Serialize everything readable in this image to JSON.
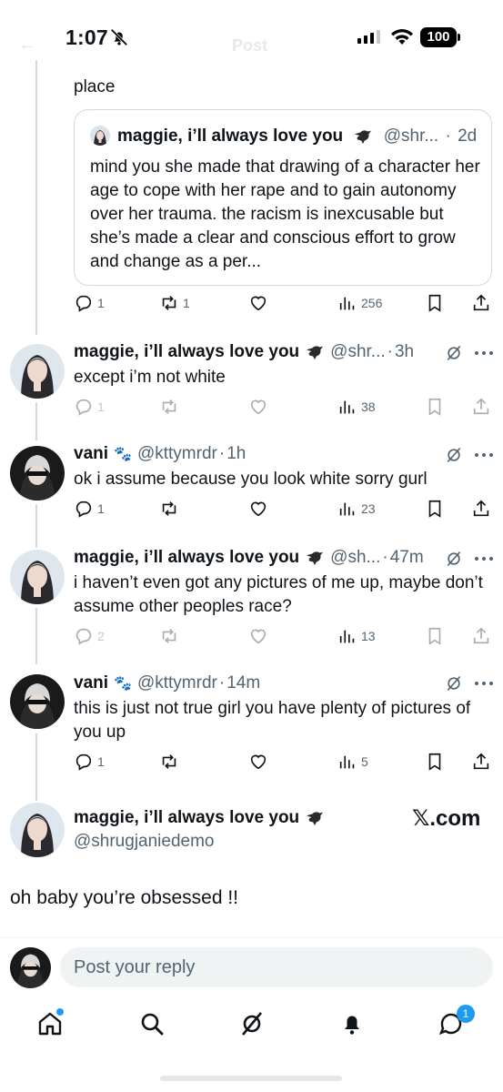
{
  "status_bar": {
    "time": "1:07",
    "battery": "100"
  },
  "header": {
    "title": "Post"
  },
  "previous_tweet": {
    "text_tail": "place"
  },
  "quote": {
    "name": "maggie, i’ll always love you",
    "handle": "@shr...",
    "time": "2d",
    "text": "mind you she made that drawing of a character her age to cope with her rape and to gain autonomy over her trauma. the racism is inexcusable but she’s made a clear and conscious effort to grow and change as a per..."
  },
  "quote_actions": {
    "replies": "1",
    "reposts": "1",
    "views": "256"
  },
  "tweets": [
    {
      "name": "maggie, i’ll always love you",
      "handle": "@shr...",
      "time": "3h",
      "text": "except i’m not white",
      "replies": "1",
      "reposts": "",
      "likes": "",
      "views": "38"
    },
    {
      "name": "vani",
      "handle": "@kttymrdr",
      "time": "1h",
      "text": "ok i assume because you look white sorry gurl",
      "replies": "1",
      "reposts": "",
      "likes": "",
      "views": "23"
    },
    {
      "name": "maggie, i’ll always love you",
      "handle": "@sh...",
      "time": "47m",
      "text": "i haven’t even got any pictures of me up, maybe don’t assume other peoples race?",
      "replies": "2",
      "reposts": "",
      "likes": "",
      "views": "13"
    },
    {
      "name": "vani",
      "handle": "@kttymrdr",
      "time": "14m",
      "text": "this is just not true girl you have plenty of pictures of you up",
      "replies": "1",
      "reposts": "",
      "likes": "",
      "views": "5"
    }
  ],
  "main_tweet": {
    "name": "maggie, i’ll always love you",
    "handle": "@shrugjaniedemo",
    "text": "oh baby you’re obsessed !!",
    "watermark": "𝕏.com"
  },
  "reply": {
    "placeholder": "Post your reply"
  },
  "tabbar": {
    "messages_badge": "1"
  },
  "colors": {
    "accent": "#1d9bf0",
    "text": "#0f1419",
    "secondary": "#536471",
    "border": "#cfd9de"
  },
  "icons": [
    "reply-icon",
    "repost-icon",
    "like-icon",
    "views-icon",
    "bookmark-icon",
    "share-icon",
    "grok-icon",
    "more-icon",
    "home-icon",
    "search-icon",
    "grok-tab-icon",
    "bell-icon",
    "messages-icon"
  ]
}
